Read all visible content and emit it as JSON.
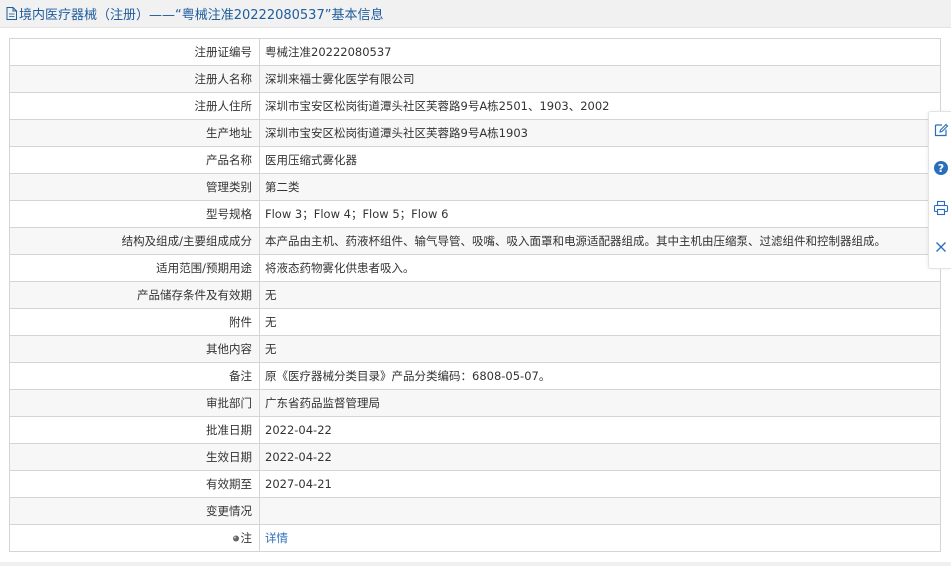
{
  "header": {
    "title": "境内医疗器械（注册）——“粤械注准20222080537”基本信息",
    "icon": "document-icon"
  },
  "colors": {
    "header_text": "#1e5d9e",
    "link": "#2a6ebb",
    "border": "#d5d5d5"
  },
  "rows": [
    {
      "label": "注册证编号",
      "value": "粤械注准20222080537"
    },
    {
      "label": "注册人名称",
      "value": "深圳来福士雾化医学有限公司"
    },
    {
      "label": "注册人住所",
      "value": "深圳市宝安区松岗街道潭头社区芙蓉路9号A栋2501、1903、2002"
    },
    {
      "label": "生产地址",
      "value": "深圳市宝安区松岗街道潭头社区芙蓉路9号A栋1903"
    },
    {
      "label": "产品名称",
      "value": "医用压缩式雾化器"
    },
    {
      "label": "管理类别",
      "value": "第二类"
    },
    {
      "label": "型号规格",
      "value": "Flow 3；Flow 4；Flow 5；Flow 6"
    },
    {
      "label": "结构及组成/主要组成成分",
      "value": "本产品由主机、药液杯组件、输气导管、吸嘴、吸入面罩和电源适配器组成。其中主机由压缩泵、过滤组件和控制器组成。"
    },
    {
      "label": "适用范围/预期用途",
      "value": "将液态药物雾化供患者吸入。"
    },
    {
      "label": "产品储存条件及有效期",
      "value": "无"
    },
    {
      "label": "附件",
      "value": "无"
    },
    {
      "label": "其他内容",
      "value": "无"
    },
    {
      "label": "备注",
      "value": "原《医疗器械分类目录》产品分类编码：6808-05-07。"
    },
    {
      "label": "审批部门",
      "value": "广东省药品监督管理局"
    },
    {
      "label": "批准日期",
      "value": "2022-04-22"
    },
    {
      "label": "生效日期",
      "value": "2022-04-22"
    },
    {
      "label": "有效期至",
      "value": "2027-04-21"
    },
    {
      "label": "变更情况",
      "value": ""
    }
  ],
  "note_row": {
    "label": "注",
    "icon": "pin-icon",
    "link_text": "详情"
  },
  "side_toolbar": {
    "icons": [
      "edit-icon",
      "help-icon",
      "print-icon",
      "close-icon"
    ]
  }
}
